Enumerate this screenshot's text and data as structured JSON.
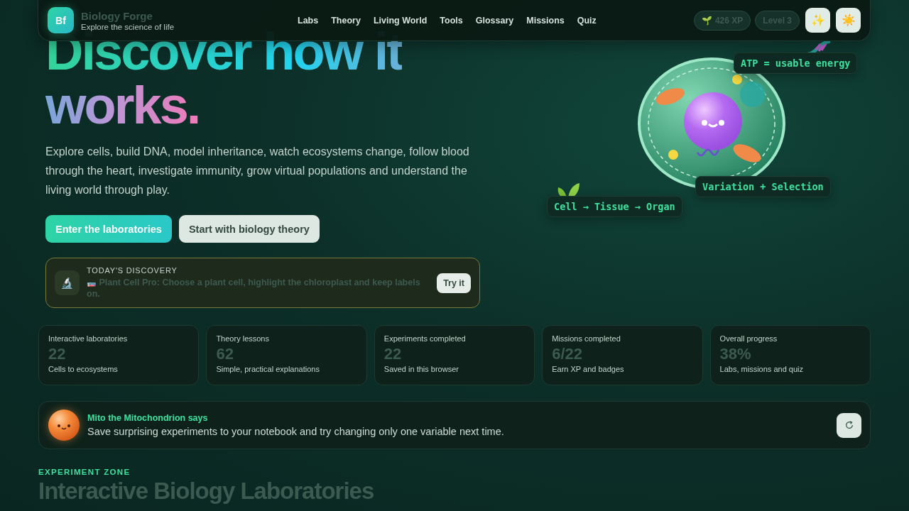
{
  "header": {
    "logo": "Bf",
    "title": "Biology Forge",
    "subtitle": "Explore the science of life",
    "nav": [
      {
        "label": "Labs",
        "selected": false
      },
      {
        "label": "Theory",
        "selected": false
      },
      {
        "label": "Living World",
        "selected": false
      },
      {
        "label": "Tools",
        "selected": false
      },
      {
        "label": "Glossary",
        "selected": false
      },
      {
        "label": "Missions",
        "selected": false
      },
      {
        "label": "Quiz",
        "selected": false
      }
    ],
    "xp": {
      "icon": "🌱",
      "label": "426 XP"
    },
    "level": "Level 3",
    "buttons": [
      "✨",
      "☀️"
    ]
  },
  "hero": {
    "title_line_1": "Discover how it",
    "title_line_2": "works.",
    "intro": "Explore cells, build DNA, model inheritance, watch ecosystems change, follow blood through the heart, investigate immunity, grow virtual populations and understand the living world through play.",
    "buttons": [
      {
        "label": "Enter the laboratories",
        "kind": "primary"
      },
      {
        "label": "Start with biology theory",
        "kind": "secondary"
      }
    ],
    "discovery": {
      "icon": "🔬",
      "eyebrow": "TODAY'S DISCOVERY",
      "emoji": "🧫",
      "text": "Plant Cell Pro: Choose a plant cell, highlight the chloroplast and keep labels on.",
      "button": "Try it"
    },
    "labels": [
      "ATP = usable energy",
      "Variation + Selection",
      "Cell → Tissue → Organ"
    ]
  },
  "stats": [
    {
      "label": "Interactive laboratories",
      "value": "22",
      "note": "Cells to ecosystems"
    },
    {
      "label": "Theory lessons",
      "value": "62",
      "note": "Simple, practical explanations"
    },
    {
      "label": "Experiments completed",
      "value": "22",
      "note": "Saved in this browser"
    },
    {
      "label": "Missions completed",
      "value": "6/22",
      "note": "Earn XP and badges"
    },
    {
      "label": "Overall progress",
      "value": "38%",
      "note": "Labs, missions and quiz"
    }
  ],
  "mascot": {
    "name": "Mito the Mitochondrion says",
    "tip": "Save surprising experiments to your notebook and try changing only one variable next time."
  },
  "section": {
    "eyebrow": "EXPERIMENT ZONE",
    "title": "Interactive Biology Laboratories"
  }
}
